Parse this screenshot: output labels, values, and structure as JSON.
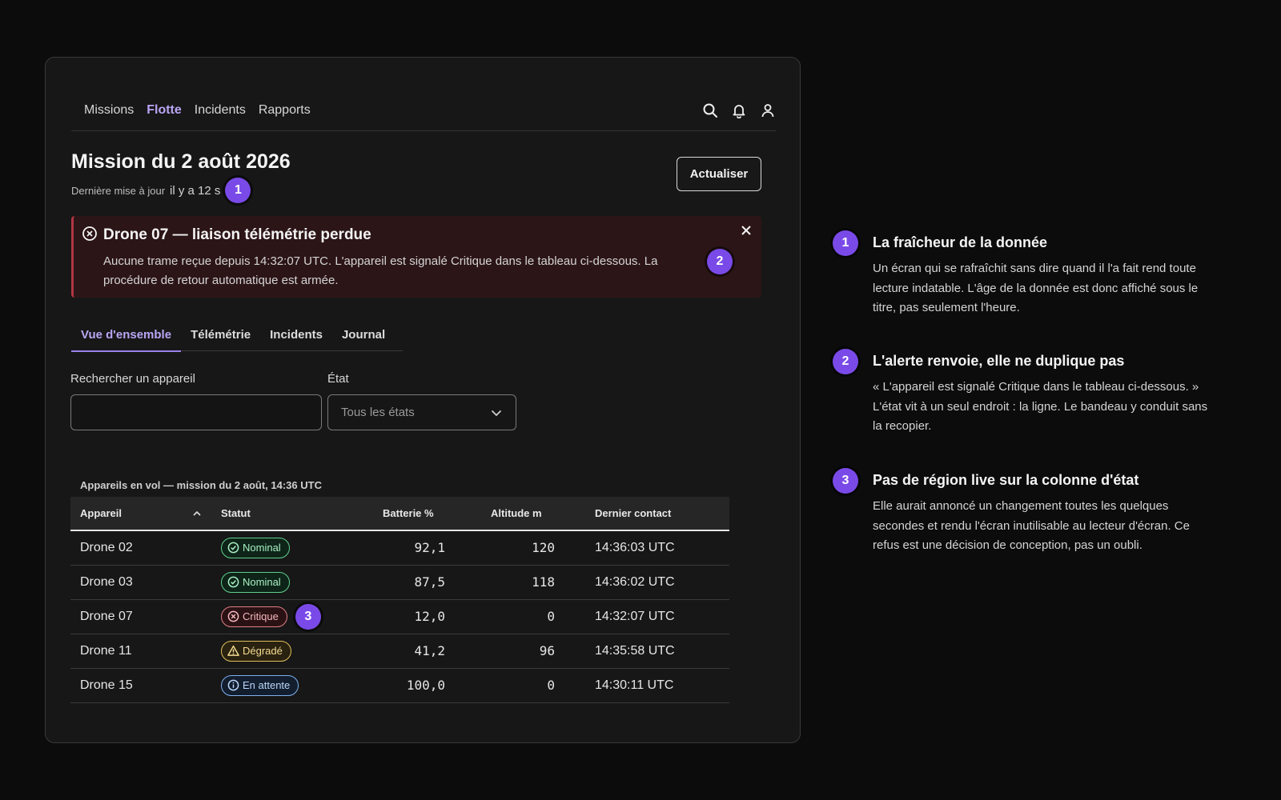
{
  "nav": {
    "links": [
      "Missions",
      "Flotte",
      "Incidents",
      "Rapports"
    ],
    "active": "Flotte",
    "icons": [
      "search-icon",
      "bell-icon",
      "user-icon"
    ]
  },
  "header": {
    "title": "Mission du 2 août 2026",
    "updated_label": "Dernière mise à jour",
    "updated_age": "il y a 12 s",
    "refresh_label": "Actualiser"
  },
  "alert": {
    "title": "Drone 07 — liaison télémétrie perdue",
    "body": "Aucune trame reçue depuis 14:32:07 UTC. L'appareil est signalé Critique dans le tableau ci-dessous. La procédure de retour automatique est armée.",
    "icon": "error-circle-icon",
    "close_icon": "close-icon"
  },
  "tabs": [
    "Vue d'ensemble",
    "Télémétrie",
    "Incidents",
    "Journal"
  ],
  "active_tab": "Vue d'ensemble",
  "filters": {
    "search_label": "Rechercher un appareil",
    "search_value": "",
    "state_label": "État",
    "state_value": "Tous les états"
  },
  "table": {
    "caption": "Appareils en vol — mission du 2 août, 14:36 UTC",
    "headers": [
      "Appareil",
      "Statut",
      "Batterie %",
      "Altitude m",
      "Dernier contact"
    ],
    "rows": [
      {
        "device": "Drone 02",
        "status": "Nominal",
        "battery": "92,1",
        "altitude": "120",
        "contact": "14:36:03 UTC"
      },
      {
        "device": "Drone 03",
        "status": "Nominal",
        "battery": "87,5",
        "altitude": "118",
        "contact": "14:36:02 UTC"
      },
      {
        "device": "Drone 07",
        "status": "Critique",
        "battery": "12,0",
        "altitude": "0",
        "contact": "14:32:07 UTC"
      },
      {
        "device": "Drone 11",
        "status": "Dégradé",
        "battery": "41,2",
        "altitude": "96",
        "contact": "14:35:58 UTC"
      },
      {
        "device": "Drone 15",
        "status": "En attente",
        "battery": "100,0",
        "altitude": "0",
        "contact": "14:30:11 UTC"
      }
    ]
  },
  "markers": [
    "1",
    "2",
    "3"
  ],
  "colors": {
    "accent": "#7a4ae8",
    "nominal": "#5fcf8e",
    "critique": "#e07f88",
    "degrade": "#e0bf5a",
    "attente": "#7fb0ee"
  },
  "notes": [
    {
      "number": "1",
      "title": "La fraîcheur de la donnée",
      "body": "Un écran qui se rafraîchit sans dire quand il l'a fait rend toute lecture indatable. L'âge de la donnée est donc affiché sous le titre, pas seulement l'heure."
    },
    {
      "number": "2",
      "title": "L'alerte renvoie, elle ne duplique pas",
      "body": "« L'appareil est signalé Critique dans le tableau ci-dessous. » L'état vit à un seul endroit : la ligne. Le bandeau y conduit sans la recopier."
    },
    {
      "number": "3",
      "title": "Pas de région live sur la colonne d'état",
      "body": "Elle aurait annoncé un changement toutes les quelques secondes et rendu l'écran inutilisable au lecteur d'écran. Ce refus est une décision de conception, pas un oubli."
    }
  ]
}
